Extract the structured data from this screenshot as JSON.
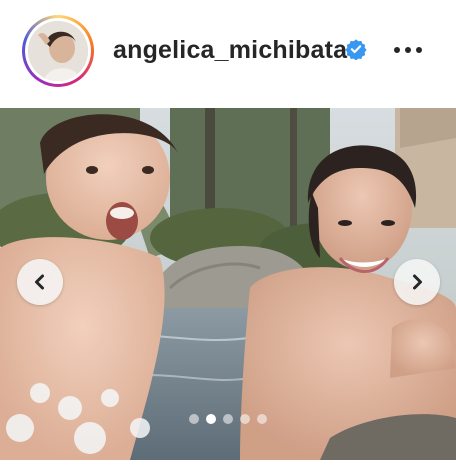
{
  "post": {
    "username": "angelica_michibata",
    "verified": true,
    "avatar_name": "profile-avatar",
    "more_icon": "more-options-icon",
    "carousel": {
      "dot_count": 5,
      "active_index": 1,
      "prev_icon": "chevron-left-icon",
      "next_icon": "chevron-right-icon"
    }
  },
  "colors": {
    "verified_badge": "#3897f0",
    "text": "#262626"
  }
}
